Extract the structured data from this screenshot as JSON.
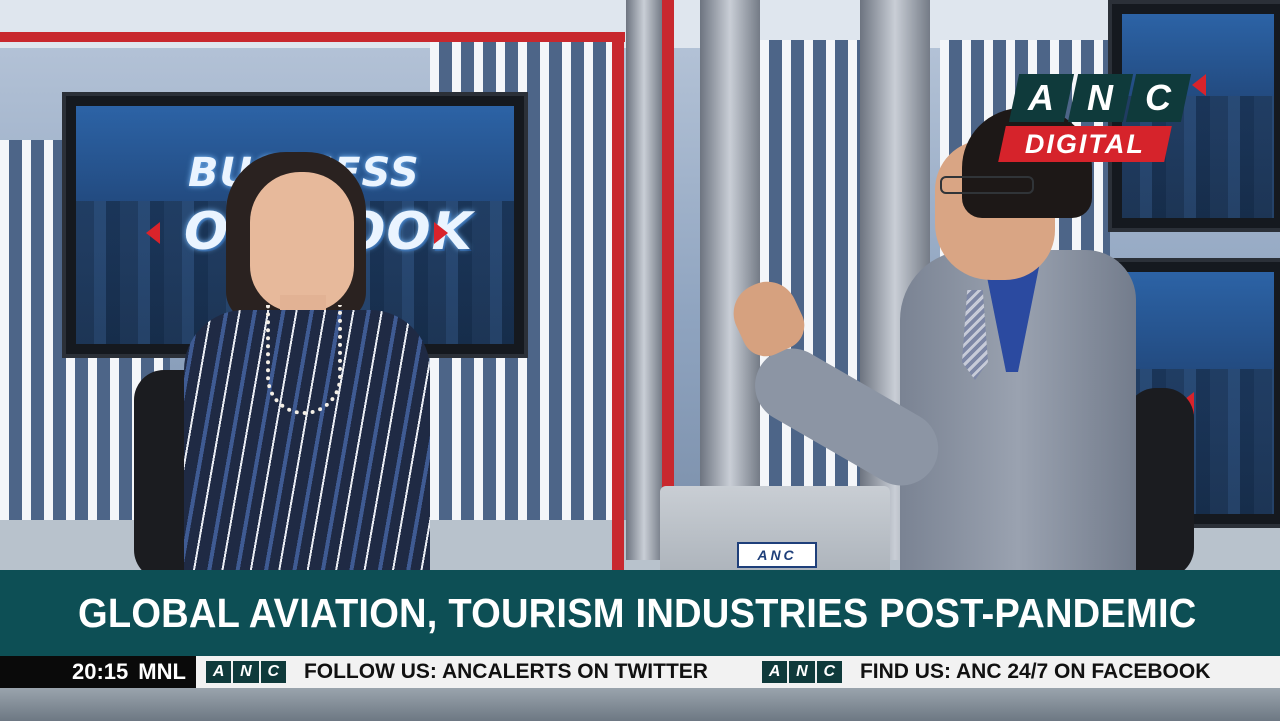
{
  "channel_bug": {
    "letters": [
      "A",
      "N",
      "C"
    ],
    "label": "DIGITAL"
  },
  "background": {
    "monitor_title_line1": "BUSINESS",
    "monitor_title_line2": "OUTLOOK",
    "laptop_logo": "ANC"
  },
  "lower_third": {
    "headline": "GLOBAL AVIATION, TOURISM INDUSTRIES POST-PANDEMIC"
  },
  "ticker": {
    "time": "20:15",
    "zone": "MNL",
    "logo": "ANC",
    "items": [
      "FOLLOW US: ANCALERTS ON TWITTER",
      "FIND US: ANC 24/7 ON FACEBOOK"
    ]
  },
  "colors": {
    "headline_bar": "#0d4f55",
    "brand_teal": "#0f3a3b",
    "brand_red": "#d6232b"
  }
}
